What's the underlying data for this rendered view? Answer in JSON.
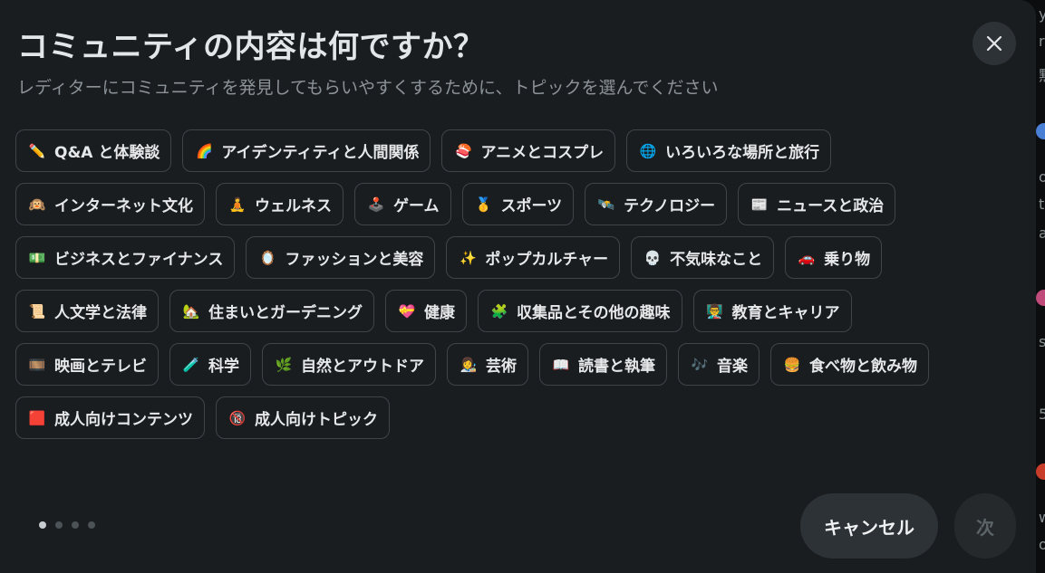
{
  "dialog": {
    "title": "コミュニティの内容は何ですか？",
    "subtitle": "レディターにコミュニティを発見してもらいやすくするために、トピックを選んでください"
  },
  "topic_rows": [
    [
      {
        "icon": "✏️",
        "label": "Q&A と体験談"
      },
      {
        "icon": "🌈",
        "label": "アイデンティティと人間関係"
      },
      {
        "icon": "🍣",
        "label": "アニメとコスプレ"
      },
      {
        "icon": "🌐",
        "label": "いろいろな場所と旅行"
      }
    ],
    [
      {
        "icon": "🙉",
        "label": "インターネット文化"
      },
      {
        "icon": "🧘",
        "label": "ウェルネス"
      },
      {
        "icon": "🕹️",
        "label": "ゲーム"
      },
      {
        "icon": "🥇",
        "label": "スポーツ"
      },
      {
        "icon": "🛰️",
        "label": "テクノロジー"
      },
      {
        "icon": "📰",
        "label": "ニュースと政治"
      }
    ],
    [
      {
        "icon": "💵",
        "label": "ビジネスとファイナンス"
      },
      {
        "icon": "🪞",
        "label": "ファッションと美容"
      },
      {
        "icon": "✨",
        "label": "ポップカルチャー"
      },
      {
        "icon": "💀",
        "label": "不気味なこと"
      },
      {
        "icon": "🚗",
        "label": "乗り物"
      }
    ],
    [
      {
        "icon": "📜",
        "label": "人文学と法律"
      },
      {
        "icon": "🏡",
        "label": "住まいとガーデニング"
      },
      {
        "icon": "💝",
        "label": "健康"
      },
      {
        "icon": "🧩",
        "label": "収集品とその他の趣味"
      },
      {
        "icon": "👨‍🏫",
        "label": "教育とキャリア"
      }
    ],
    [
      {
        "icon": "🎞️",
        "label": "映画とテレビ"
      },
      {
        "icon": "🧪",
        "label": "科学"
      },
      {
        "icon": "🌿",
        "label": "自然とアウトドア"
      },
      {
        "icon": "👩‍🎨",
        "label": "芸術"
      },
      {
        "icon": "📖",
        "label": "読書と執筆"
      },
      {
        "icon": "🎶",
        "label": "音楽"
      },
      {
        "icon": "🍔",
        "label": "食べ物と飲み物"
      }
    ],
    [
      {
        "icon": "🟥",
        "label": "成人向けコンテンツ"
      },
      {
        "icon": "🔞",
        "label": "成人向けトピック"
      }
    ]
  ],
  "pagination": {
    "total_steps": 4,
    "current_step": 1
  },
  "buttons": {
    "cancel_label": "キャンセル",
    "next_label": "次"
  },
  "background_edge_text": [
    "y",
    "rt",
    "黙",
    "o",
    "th",
    "a",
    "st",
    "5",
    "w",
    "or"
  ]
}
